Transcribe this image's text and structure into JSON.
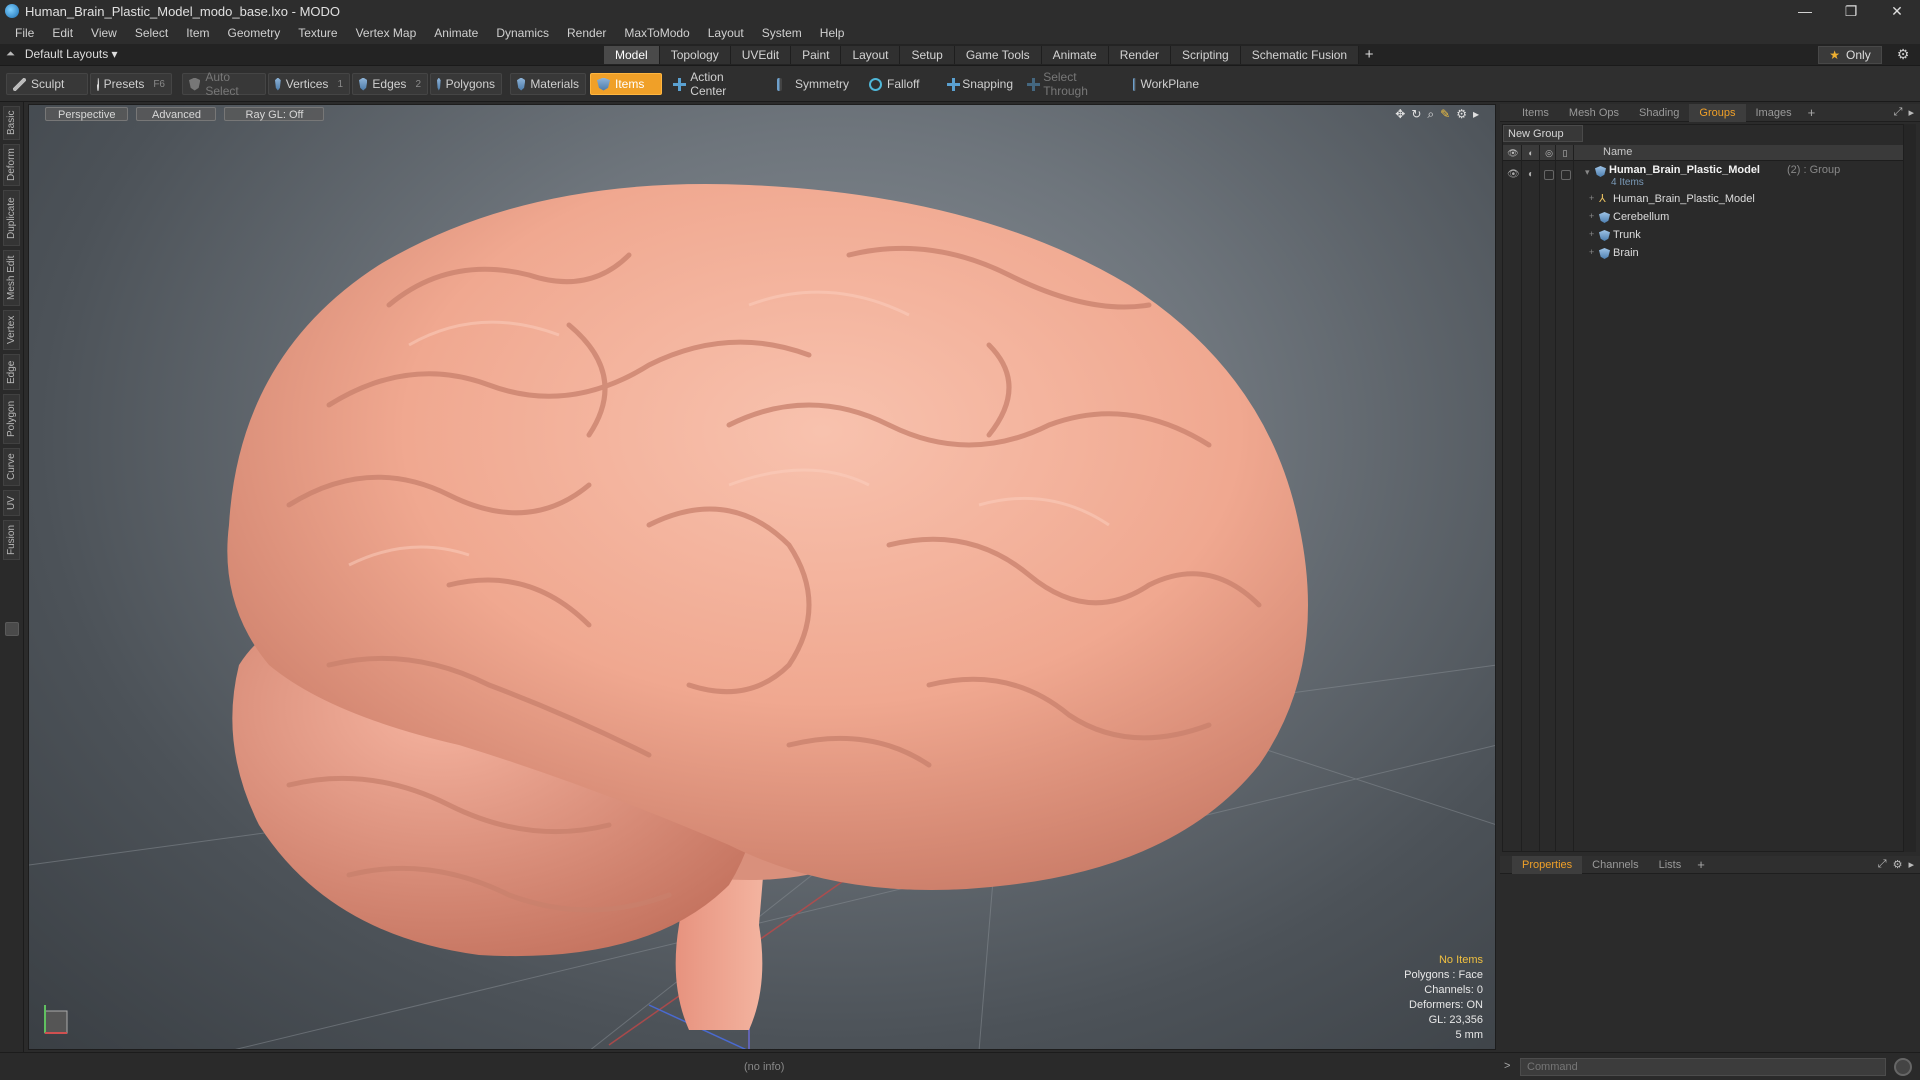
{
  "window": {
    "title": "Human_Brain_Plastic_Model_modo_base.lxo - MODO",
    "minimize": "—",
    "restore": "❐",
    "close": "✕"
  },
  "menu": [
    "File",
    "Edit",
    "View",
    "Select",
    "Item",
    "Geometry",
    "Texture",
    "Vertex Map",
    "Animate",
    "Dynamics",
    "Render",
    "MaxToModo",
    "Layout",
    "System",
    "Help"
  ],
  "layoutbar": {
    "layout_selector": "Default Layouts ▾",
    "tabs": [
      "Model",
      "Topology",
      "UVEdit",
      "Paint",
      "Layout",
      "Setup",
      "Game Tools",
      "Animate",
      "Render",
      "Scripting",
      "Schematic Fusion"
    ],
    "active_tab": "Model",
    "add_label": "+",
    "only_label": "Only"
  },
  "toolbar": {
    "sculpt": "Sculpt",
    "presets": "Presets",
    "presets_hotkey": "F6",
    "auto_select": "Auto Select",
    "vertices": "Vertices",
    "vertices_hotkey": "1",
    "edges": "Edges",
    "edges_hotkey": "2",
    "polygons": "Polygons",
    "materials": "Materials",
    "items": "Items",
    "action_center": "Action Center",
    "symmetry": "Symmetry",
    "falloff": "Falloff",
    "snapping": "Snapping",
    "select_through": "Select Through",
    "workplane": "WorkPlane"
  },
  "left_tabs": [
    "Basic",
    "Deform",
    "Duplicate",
    "Mesh Edit",
    "Vertex",
    "Edge",
    "Polygon",
    "Curve",
    "UV",
    "Fusion"
  ],
  "viewport": {
    "view_mode": "Perspective",
    "shading": "Advanced",
    "raygl": "Ray GL: Off",
    "info": {
      "selection": "No Items",
      "polygons": "Polygons : Face",
      "channels": "Channels: 0",
      "deformers": "Deformers: ON",
      "gl": "GL: 23,356",
      "scale": "5 mm"
    }
  },
  "right_panel": {
    "tabs": [
      "Items",
      "Mesh Ops",
      "Shading",
      "Groups",
      "Images"
    ],
    "active_tab": "Groups",
    "new_group": "New Group",
    "name_header": "Name",
    "group": {
      "name": "Human_Brain_Plastic_Model",
      "meta": "(2) : Group",
      "count": "4 Items",
      "children": [
        {
          "name": "Human_Brain_Plastic_Model",
          "icon": "locator-icon"
        },
        {
          "name": "Cerebellum",
          "icon": "mesh-icon"
        },
        {
          "name": "Trunk",
          "icon": "mesh-icon"
        },
        {
          "name": "Brain",
          "icon": "mesh-icon"
        }
      ]
    },
    "bottom_tabs": [
      "Properties",
      "Channels",
      "Lists"
    ],
    "bottom_active": "Properties"
  },
  "status": {
    "info": "(no info)",
    "command_placeholder": "Command"
  },
  "colors": {
    "accent": "#f0a028",
    "brain": "#f0a890",
    "viewport_bg": "#6e757c"
  }
}
